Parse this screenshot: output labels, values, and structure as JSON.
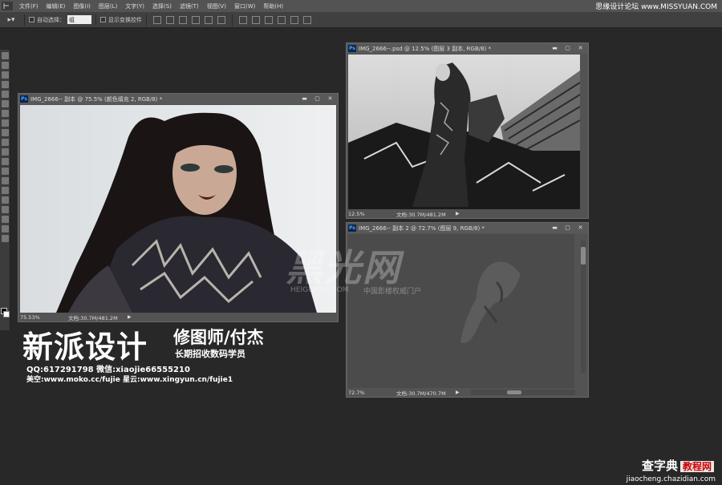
{
  "menubar": {
    "logo": "Ps",
    "items": [
      "文件(F)",
      "编辑(E)",
      "图像(I)",
      "图层(L)",
      "文字(Y)",
      "选择(S)",
      "滤镜(T)",
      "视图(V)",
      "窗口(W)",
      "帮助(H)"
    ],
    "brand": "思缘设计论坛 www.MISSYUAN.COM"
  },
  "options": {
    "auto_select_label": "自动选择：",
    "auto_select_value": "组",
    "show_transform_label": "显示变换控件"
  },
  "windows": [
    {
      "title": "IMG_2666-- 副本 @ 75.5% (颜色填充 2, RGB/8) *",
      "zoom": "75.53%",
      "doc_info": "文档:30.7M/481.2M"
    },
    {
      "title": "IMG_2666--.psd @ 12.5% (图层 3 副本, RGB/8) *",
      "zoom": "12.5%",
      "doc_info": "文档:30.7M/481.2M"
    },
    {
      "title": "IMG_2666-- 副本 2 @ 72.7% (图层 9, RGB/8) *",
      "zoom": "72.7%",
      "doc_info": "文档:30.7M/470.7M"
    }
  ],
  "promo": {
    "title": "新派设计",
    "role": "修图师/付杰",
    "subtitle": "长期招收数码学员",
    "qq": "QQ:617291798 微信:xiaojie66555210",
    "web": "美空:www.moko.cc/fujie 星云:www.xingyun.cn/fujie1"
  },
  "watermark": {
    "big": "黑光网",
    "url": "HEIGUANG.COM",
    "cn": "中国影楼权威门户"
  },
  "footer": {
    "logo": "查字典",
    "badge": "教程网",
    "url": "jiaocheng.chazidian.com"
  }
}
